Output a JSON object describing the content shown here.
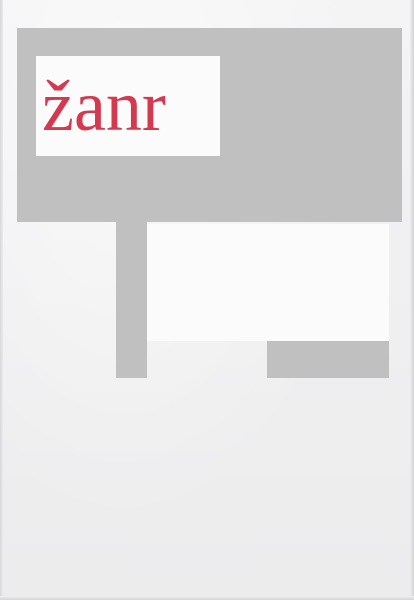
{
  "cover": {
    "title": "žanr",
    "colors": {
      "title": "#d3394f",
      "redaction": "#c0c0c0",
      "paper": "#f1f1f1",
      "panel": "#fbfbfb"
    }
  }
}
